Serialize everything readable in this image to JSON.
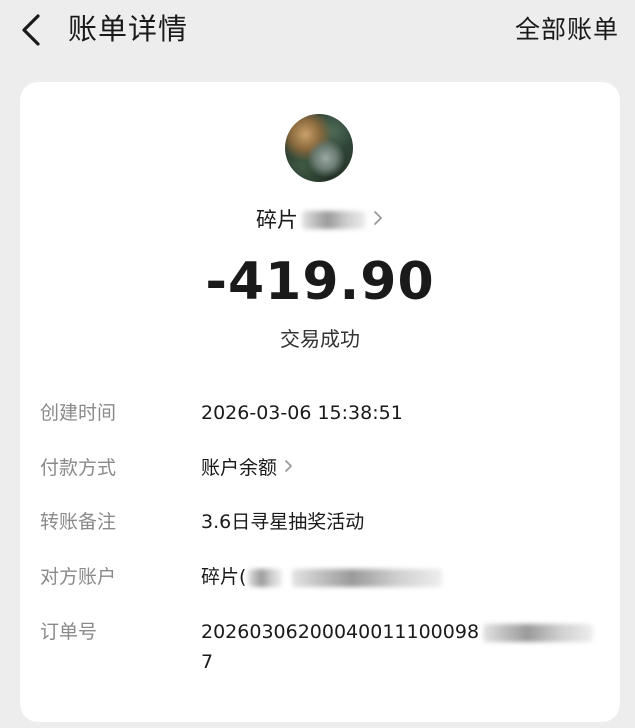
{
  "header": {
    "title": "账单详情",
    "all_bills_label": "全部账单"
  },
  "summary": {
    "counterparty_name": "碎片",
    "amount": "-419.90",
    "status": "交易成功"
  },
  "details": {
    "created_time": {
      "label": "创建时间",
      "value": "2026-03-06 15:38:51"
    },
    "payment_method": {
      "label": "付款方式",
      "value": "账户余额"
    },
    "transfer_note": {
      "label": "转账备注",
      "value": "3.6日寻星抽奖活动"
    },
    "counterparty_account": {
      "label": "对方账户",
      "value": "碎片("
    },
    "order_number": {
      "label": "订单号",
      "value_part1": "20260306200040011100098",
      "value_part2": "7"
    }
  }
}
